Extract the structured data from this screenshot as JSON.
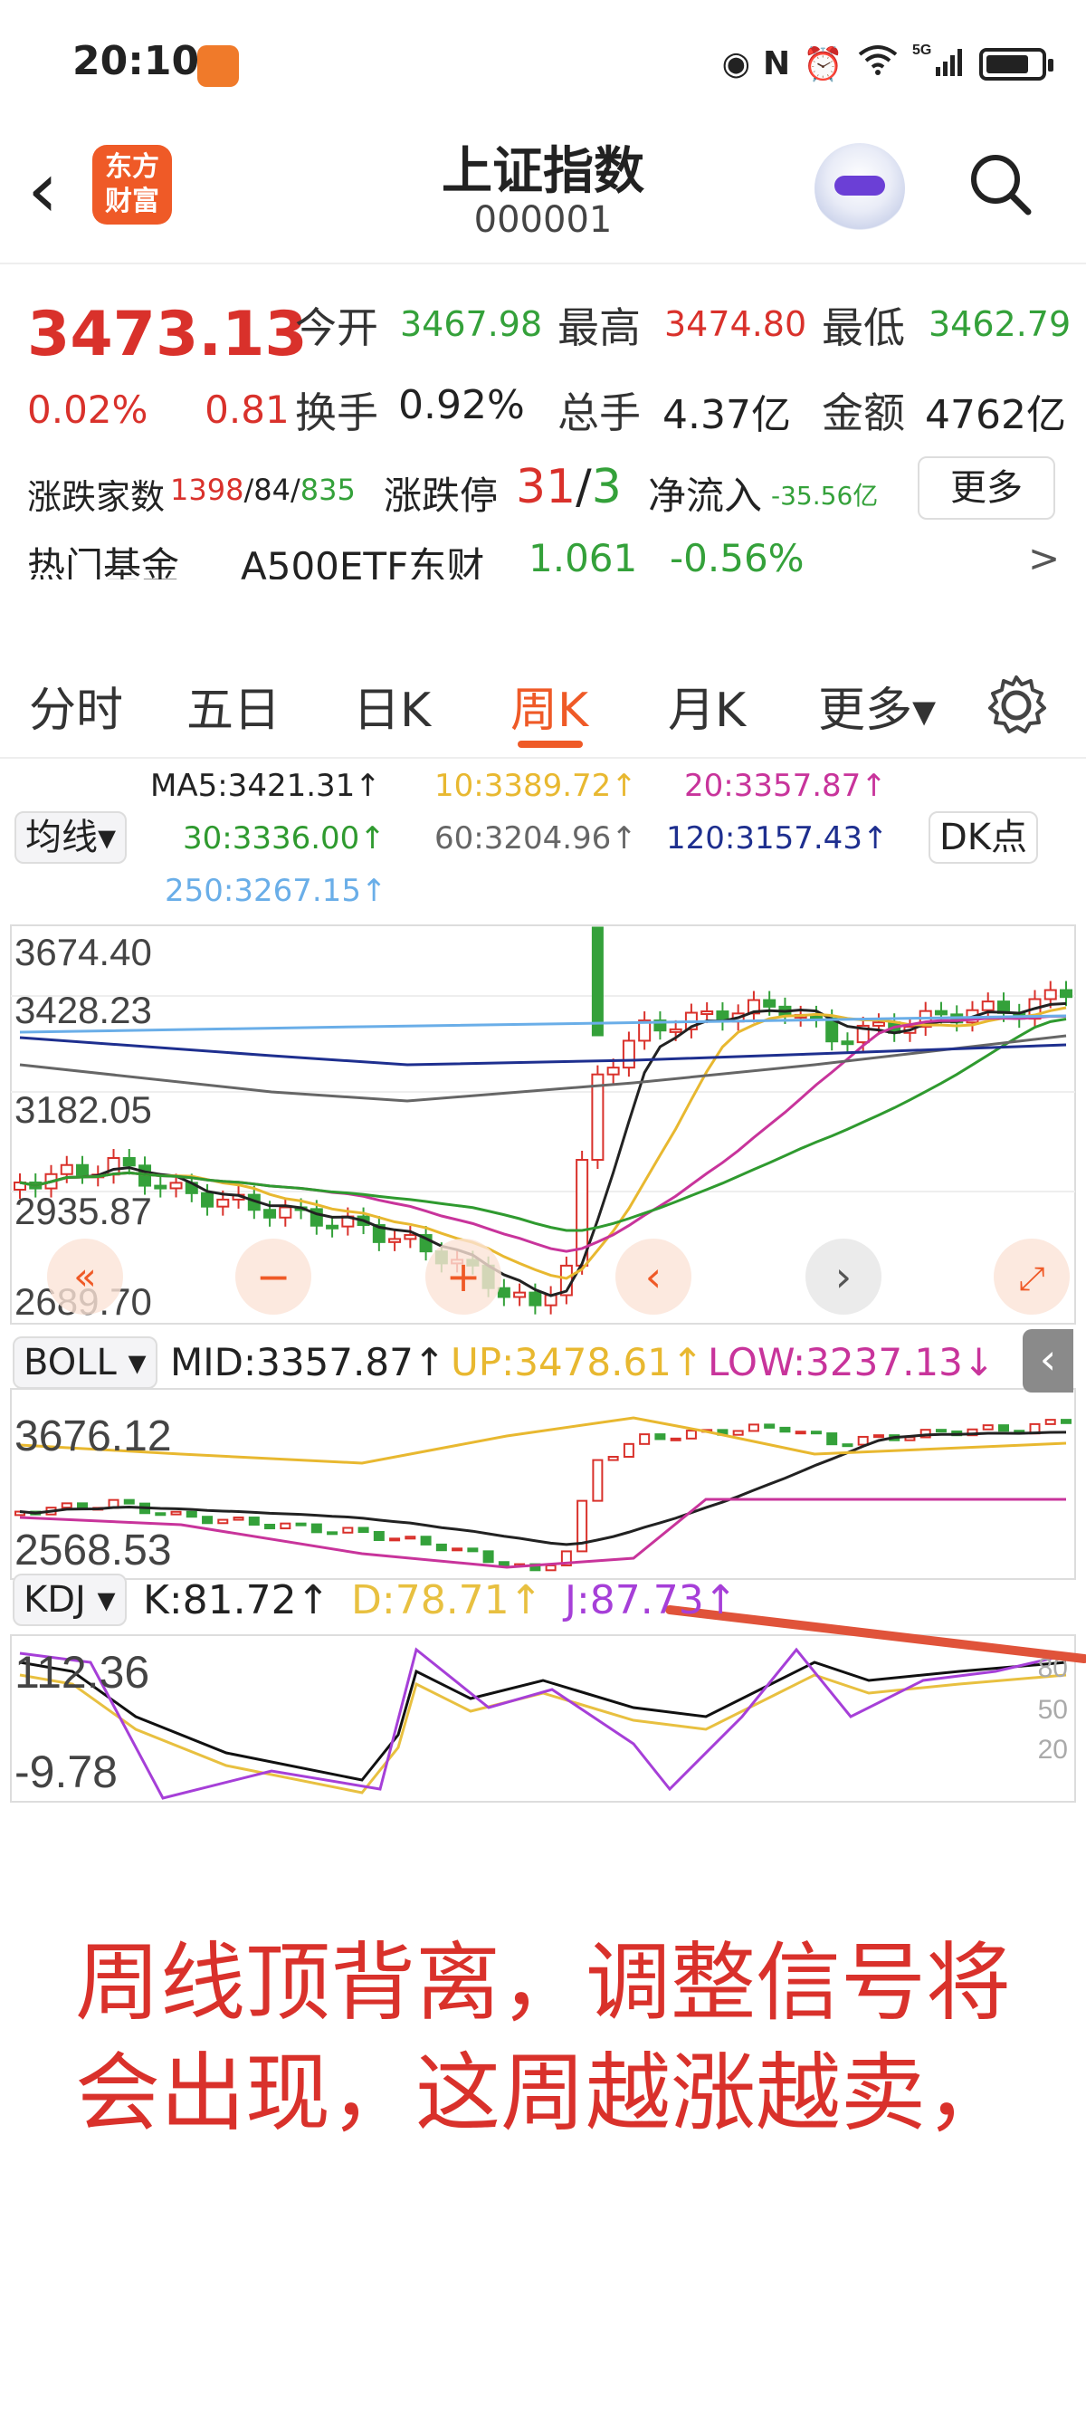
{
  "status": {
    "time": "20:10",
    "signal_label": "5G",
    "wifi_label": "6"
  },
  "header": {
    "back": "‹",
    "logo_line1": "东方",
    "logo_line2": "财富",
    "title": "上证指数",
    "code": "000001"
  },
  "quote": {
    "price": "3473.13",
    "change_pct": "0.02%",
    "change_val": "0.81",
    "open_label": "今开",
    "open": "3467.98",
    "high_label": "最高",
    "high": "3474.80",
    "low_label": "最低",
    "low": "3462.79",
    "turnover_label": "换手",
    "turnover": "0.92%",
    "volume_label": "总手",
    "volume": "4.37亿",
    "amount_label": "金额",
    "amount": "4762亿",
    "breadth_label": "涨跌家数",
    "breadth_up": "1398",
    "breadth_flat": "84",
    "breadth_down": "835",
    "limit_label": "涨跌停",
    "limit_up": "31",
    "limit_down": "3",
    "netflow_label": "净流入",
    "netflow": "-35.56亿",
    "more": "更多"
  },
  "fund": {
    "label": "热门基金",
    "name": "A500ETF东财",
    "price": "1.061",
    "change": "-0.56%",
    "arrow": ">"
  },
  "tabs": [
    {
      "label": "分时"
    },
    {
      "label": "五日"
    },
    {
      "label": "日K"
    },
    {
      "label": "周K"
    },
    {
      "label": "月K"
    },
    {
      "label": "更多▾"
    }
  ],
  "ma": {
    "selector": "均线▾",
    "ma5": "MA5:3421.31↑",
    "ma10": "10:3389.72↑",
    "ma20": "20:3357.87↑",
    "ma30": "30:3336.00↑",
    "ma60": "60:3204.96↑",
    "ma120": "120:3157.43↑",
    "ma250": "250:3267.15↑",
    "dk": "DK点"
  },
  "colors": {
    "up": "#d9312b",
    "down": "#34a13a",
    "ma5": "#222222",
    "ma10": "#e8b830",
    "ma20": "#c8349b",
    "ma30": "#2f9a2f",
    "ma60": "#666666",
    "ma120": "#1e2f8f",
    "ma250": "#6aaee8",
    "kdj_k": "#111111",
    "kdj_d": "#e8c040",
    "kdj_j": "#a63fd8",
    "accent": "#ef5a27"
  },
  "chart_data": [
    {
      "type": "candlestick",
      "title": "",
      "y_ticks": [
        "3674.40",
        "3428.23",
        "3182.05",
        "2935.87",
        "2689.70"
      ],
      "ylim": [
        2689.7,
        3674.4
      ]
    },
    {
      "type": "line",
      "title": "BOLL",
      "y_ticks": [
        "3676.12",
        "2568.53"
      ]
    },
    {
      "type": "line",
      "title": "KDJ",
      "y_ticks": [
        "112.36",
        "-9.78"
      ],
      "right_ticks": [
        "80",
        "50",
        "20"
      ]
    }
  ],
  "boll": {
    "selector": "BOLL ▾",
    "mid": "MID:3357.87↑",
    "up": "UP:3478.61↑",
    "low": "LOW:3237.13↓"
  },
  "kdj": {
    "selector": "KDJ ▾",
    "k": "K:81.72↑",
    "d": "D:78.71↑",
    "j": "J:87.73↑"
  },
  "note": {
    "line1": "周线顶背离，调整信号将",
    "line2": "会出现，这周越涨越卖，"
  }
}
